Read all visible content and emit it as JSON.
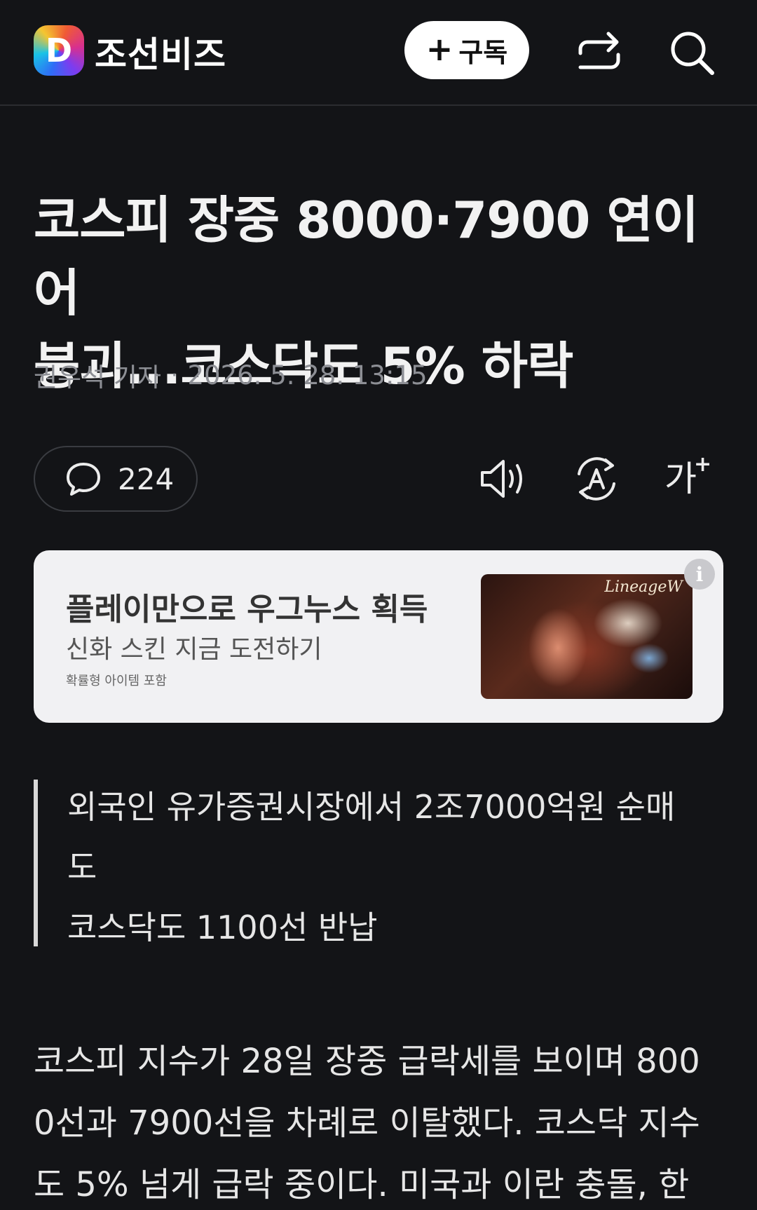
{
  "header": {
    "logo_letter": "D",
    "brand_name": "조선비즈",
    "subscribe_plus": "+",
    "subscribe_label": "구독"
  },
  "article": {
    "title_line1": "코스피 장중 8000·7900 연이어",
    "title_line2": "붕괴...코스닥도 5% 하락",
    "author": "권우석 기자",
    "separator": "·",
    "datetime": "2026. 5. 28. 13:15",
    "comment_count": "224",
    "font_size_glyph": "가",
    "font_size_plus": "+",
    "summary": [
      "외국인 유가증권시장에서 2조7000억원 순매",
      "도",
      "코스닥도 1100선 반납"
    ],
    "body_lines": [
      "코스피 지수가 28일 장중 급락세를 보이며 800",
      "0선과 7900선을 차례로 이탈했다. 코스닥 지수",
      "도 5% 넘게 급락 중이다. 미국과 이란 충돌, 한"
    ]
  },
  "ad": {
    "headline": "플레이만으로 우그누스 획득",
    "subline": "신화 스킨 지금 도전하기",
    "note": "확률형 아이템 포함",
    "image_brand": "LineageW",
    "info_glyph": "i"
  }
}
